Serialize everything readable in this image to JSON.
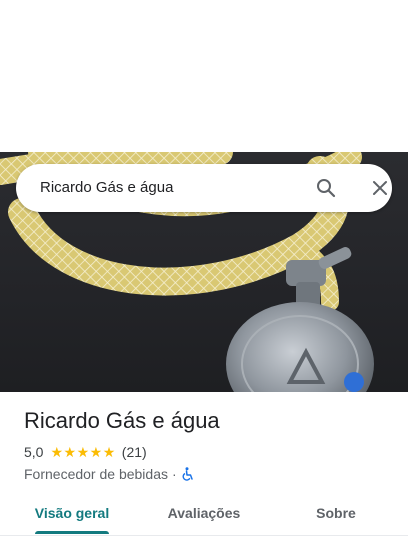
{
  "search": {
    "query": "Ricardo Gás e água",
    "search_icon": "search-icon",
    "close_icon": "close-icon"
  },
  "place": {
    "name": "Ricardo Gás e água",
    "rating": "5,0",
    "stars": "★★★★★",
    "star_count": 5,
    "reviews": "(21)",
    "category": "Fornecedor de bebidas",
    "separator": "·",
    "accessibility_icon": "wheelchair-accessible-icon"
  },
  "tabs": [
    {
      "label": "Visão geral",
      "active": true
    },
    {
      "label": "Avaliações",
      "active": false
    },
    {
      "label": "Sobre",
      "active": false
    }
  ],
  "colors": {
    "accent": "#137a7f",
    "star": "#fbbc04",
    "accessibility": "#1a73e8"
  }
}
